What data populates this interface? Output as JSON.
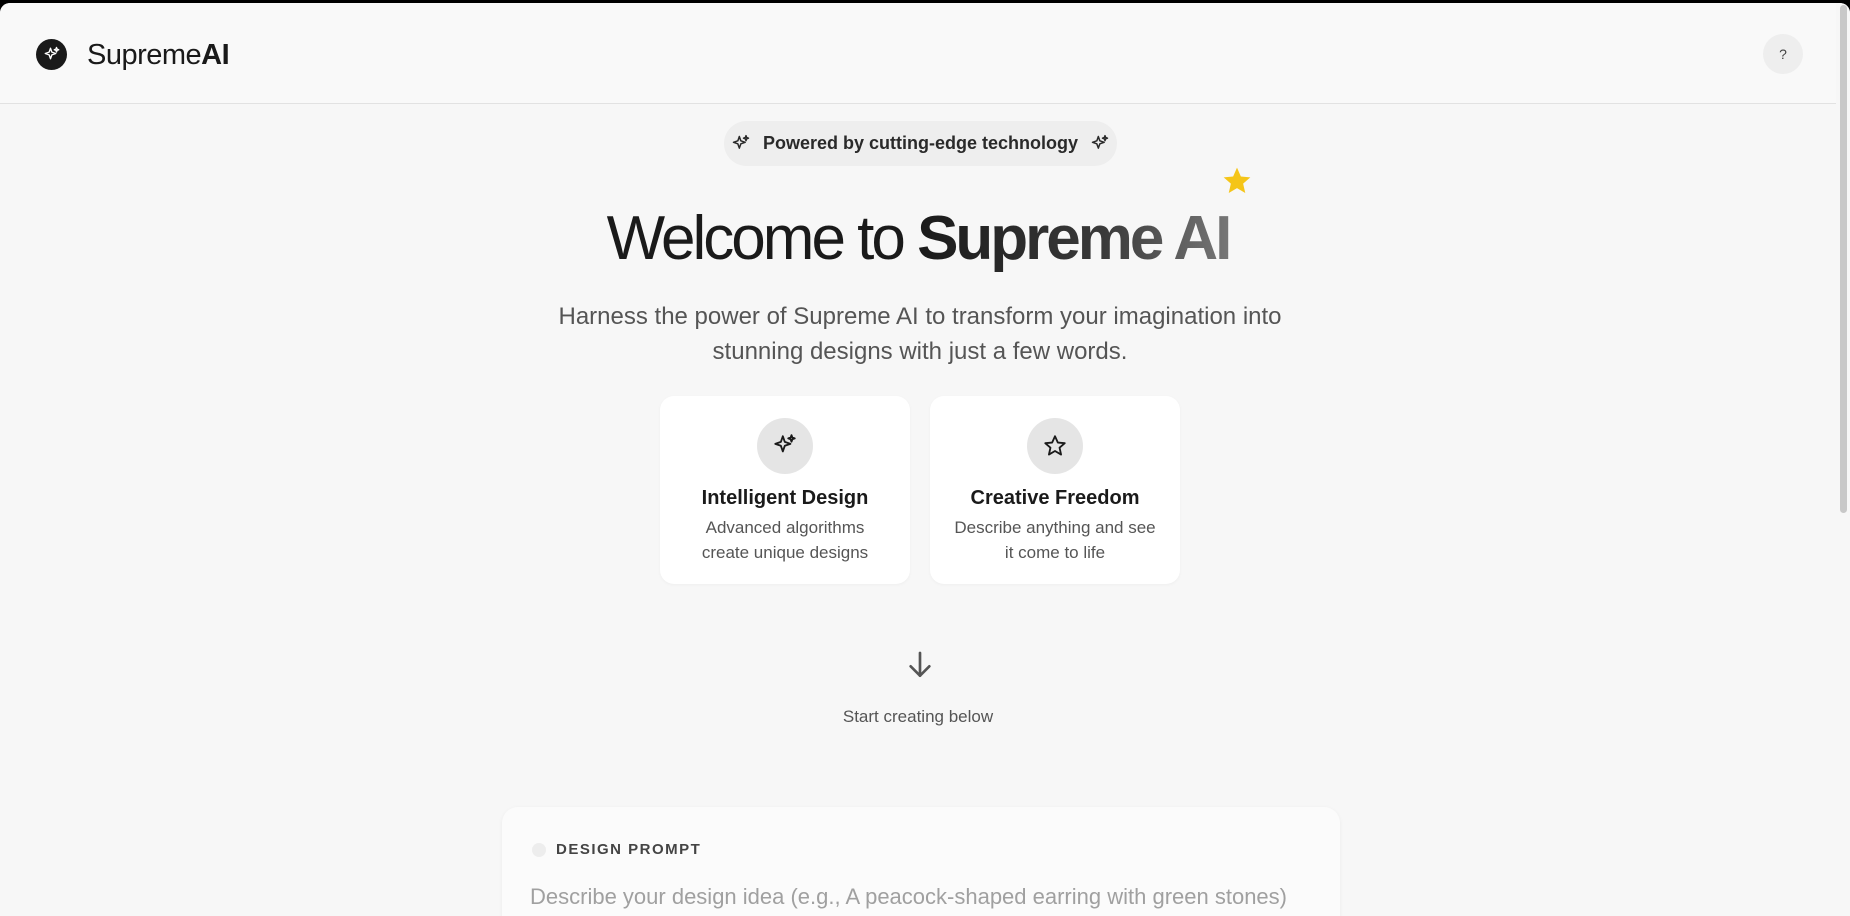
{
  "header": {
    "brand_prefix": "Supreme",
    "brand_suffix": "AI",
    "help_label": "?"
  },
  "badge": {
    "text": "Powered by cutting-edge technology"
  },
  "hero": {
    "title_light": "Welcome to ",
    "title_bold": "Supreme AI",
    "subtitle": "Harness the power of Supreme AI to transform your imagination into stunning designs with just a few words."
  },
  "features": [
    {
      "icon": "sparkles-icon",
      "title": "Intelligent Design",
      "desc": "Advanced algorithms create unique designs"
    },
    {
      "icon": "star-icon",
      "title": "Creative Freedom",
      "desc": "Describe anything and see it come to life"
    }
  ],
  "cta": {
    "text": "Start creating below"
  },
  "prompt": {
    "label": "DESIGN PROMPT",
    "placeholder": "Describe your design idea (e.g., A peacock-shaped earring with green stones)",
    "value": ""
  },
  "colors": {
    "accent_star": "#f5c518",
    "text_dark": "#1a1a1a",
    "background": "#f7f7f7"
  }
}
